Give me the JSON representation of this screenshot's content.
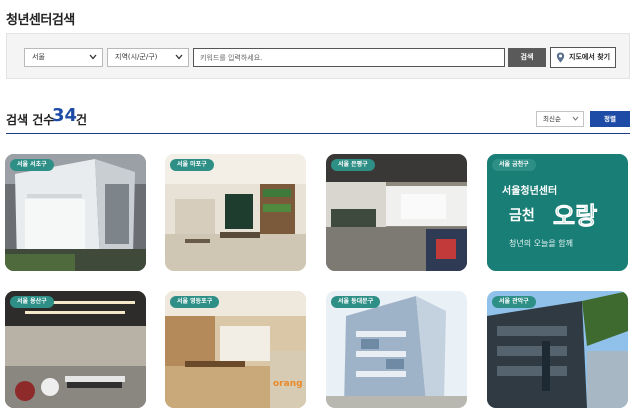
{
  "page": {
    "title": "청년센터검색"
  },
  "search": {
    "city": "서울",
    "district": "지역(시/군/구)",
    "keyword_placeholder": "키워드를 입력하세요.",
    "search_label": "검색",
    "map_label": "지도에서 찾기"
  },
  "results": {
    "count_label": "검색 건수",
    "count": "34",
    "count_unit": "건",
    "sort_value": "최신순",
    "sort_button": "정렬"
  },
  "cards": [
    {
      "badge": "서울 서초구"
    },
    {
      "badge": "서울 마포구"
    },
    {
      "badge": "서울 은평구"
    },
    {
      "badge": "서울 금천구",
      "sign_title": "서울청년센터",
      "sign_name": "금천",
      "sign_script": "오랑",
      "sign_tagline": "청년의 오늘을 함께"
    },
    {
      "badge": "서울 용산구"
    },
    {
      "badge": "서울 영등포구",
      "sign_script": "orang"
    },
    {
      "badge": "서울 동대문구"
    },
    {
      "badge": "서울 관악구"
    }
  ],
  "colors": {
    "accent": "#1e4ba5",
    "badge": "#2e8f86",
    "search_button": "#5a5a5a"
  }
}
